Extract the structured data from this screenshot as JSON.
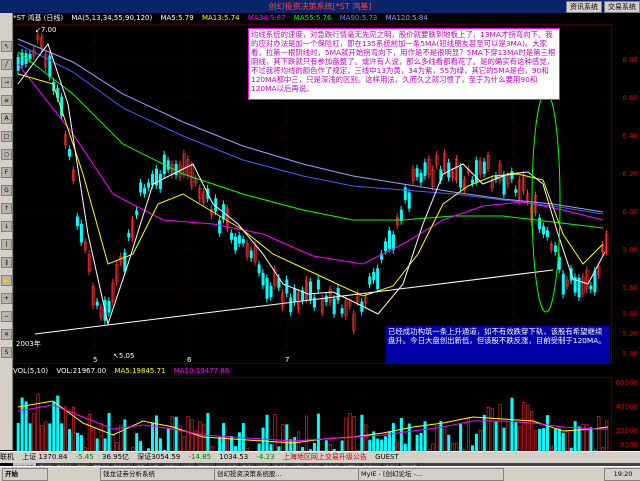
{
  "window": {
    "title": "创幻投资决策系统[*ST 鸿基]",
    "buttons": [
      "资讯系统",
      "交易系统"
    ]
  },
  "chart_header": {
    "stock": "*ST 鸿基 (日线)",
    "ma_params": "MA(5,13,34,55,90,120)",
    "ma5": "MA5:5.79",
    "ma13": "MA13:5.74",
    "ma34": "MA34:5.87",
    "ma55": "MA55:5.76",
    "ma90": "MA90:5.73",
    "ma120": "MA120:5.84"
  },
  "price_axis": [
    "6.80",
    "6.60",
    "6.40",
    "6.20",
    "6.00",
    "5.80",
    "5.60",
    "5.40",
    "5.20",
    "5.00"
  ],
  "price_labels": {
    "high": "7.00",
    "low": "5.05"
  },
  "time_axis": [
    "2003年",
    "5",
    "6",
    "7",
    "8",
    "9",
    "7"
  ],
  "annotation_top": "均线系统的速度，对急跌行情毫无先见之明，股价就要跌到地板上了，13MA才拐弯向下。我的应对办法是加一个保险杠，即在135系统前加一条5MA(短线朋友甚至可以是3MA)。大家看，拉第一根阴线时，5MA就开始拐弯向下，用作是不是很明显？5MA下穿13MA时是第三根阴线，其下跌就只有参加盘整了。或许有人说，那么多线看都看花了。是的确实有这种感觉，不过我将均线的颜色作了规定，三线中13为黄，34为紫，55为绿，其它的5MA是白，90和120MA都中三，只是深浅的区别。这样用法，久而久之就习惯了，至于为什么要用90和120MA以后再说。",
  "annotation_bottom": "已经成功构筑一条上升通道，如不有效跌穿下轨，该股有希望继续盘升。今日大盘创出新低，但该股不跌反涨，目前受制于120MA。",
  "volume_header": {
    "label": "VOL(5,10)",
    "vol": "VOL:21967.00",
    "ma5": "MA5:19845.71",
    "ma10": "MA10:19477.86"
  },
  "volume_axis": [
    "60000",
    "40000",
    "20000",
    "X100"
  ],
  "volume_bottom_label": "日线",
  "indicator_tabs": [
    "MACD",
    "DMI",
    "DMA",
    "FSL",
    "TRIX",
    "BRAR",
    "CR",
    "VR",
    "OBV",
    "ASI",
    "EMV",
    "WVAD",
    "RSI",
    "WR",
    "SAR",
    "KDJ",
    "CCI",
    "ROC",
    "MTM",
    "BOLL",
    "PSY",
    "ZMF"
  ],
  "status_bar": {
    "left": "联机",
    "index1": "上证 1370.84",
    "change1": "-5.45",
    "amount1": "36.95亿",
    "index2": "深证3054.59",
    "change2": "-14.85",
    "amount2": "1034.53",
    "extra": "-4.23",
    "news": "上海地区网上交易升级公告",
    "right": "GUEST"
  },
  "taskbar": {
    "start": "开始",
    "tasks": [
      "钱龙证券分析系统",
      "创幻投资决策系统股...",
      "MyIE - [创幻论坛 -..."
    ],
    "clock": "19:20"
  },
  "colors": {
    "ma5": "#ffffff",
    "ma13": "#ffff00",
    "ma34": "#ff00ff",
    "ma55": "#00ff00",
    "ma90": "#4060ff",
    "ma120": "#a0a0ff",
    "up": "#ff3030",
    "down": "#00ffff"
  }
}
